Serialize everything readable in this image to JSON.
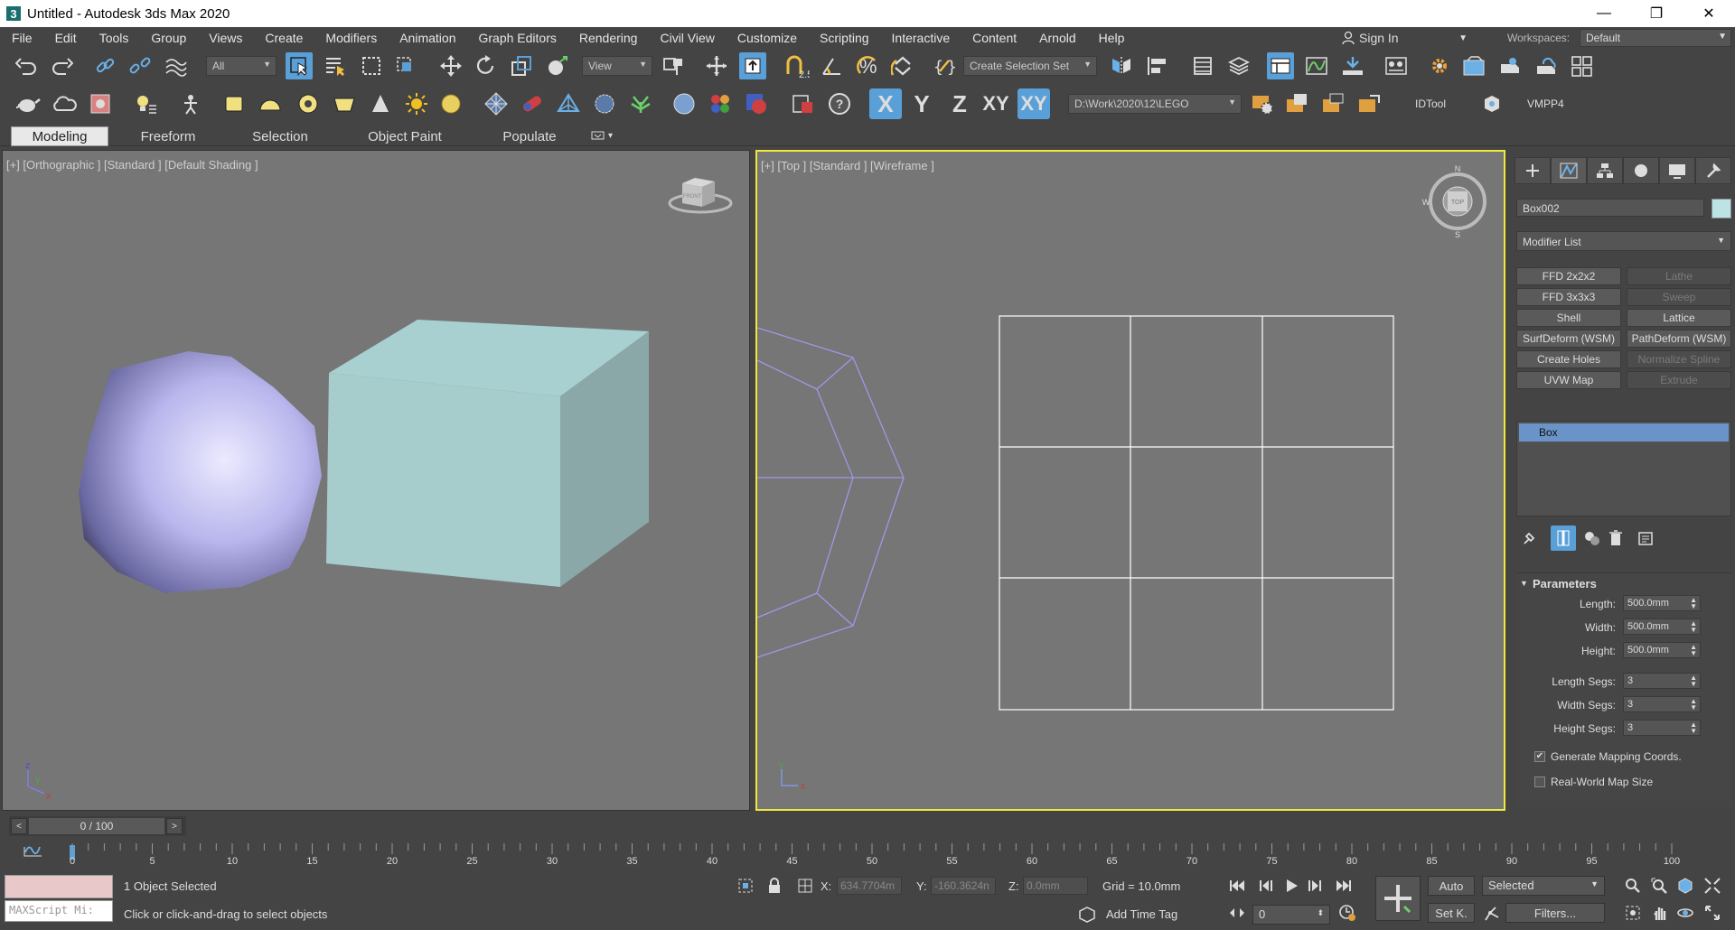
{
  "window": {
    "title": "Untitled - Autodesk 3ds Max 2020",
    "minimize": "—",
    "maximize": "❐",
    "close": "✕"
  },
  "menu": [
    "File",
    "Edit",
    "Tools",
    "Group",
    "Views",
    "Create",
    "Modifiers",
    "Animation",
    "Graph Editors",
    "Rendering",
    "Civil View",
    "Customize",
    "Scripting",
    "Interactive",
    "Content",
    "Arnold",
    "Help"
  ],
  "sign_in": "Sign In",
  "workspaces": {
    "label": "Workspaces:",
    "value": "Default"
  },
  "toolbar1": {
    "filter_value": "All",
    "ref_coord_value": "View",
    "selection_set_value": "Create Selection Set",
    "snap_label": "2.5"
  },
  "toolbar2": {
    "axis_x": "X",
    "axis_y": "Y",
    "axis_z": "Z",
    "axis_xy": "XY",
    "axis_xyz": "XY",
    "project_path": "D:\\Work\\2020\\12\\LEGO",
    "idtool": "IDTool",
    "vmpp4": "VMPP4"
  },
  "ribbon_tabs": [
    "Modeling",
    "Freeform",
    "Selection",
    "Object Paint",
    "Populate"
  ],
  "viewports": {
    "left_label": "[+] [Orthographic ] [Standard ] [Default Shading ]",
    "right_label": "[+] [Top ] [Standard ] [Wireframe ]",
    "viewcube_left": "FRONT",
    "viewcube_right": "TOP",
    "compass_n": "N",
    "compass_s": "S",
    "compass_w": "W",
    "axis_x": "x",
    "axis_y": "y",
    "axis_z": "z"
  },
  "command_panel": {
    "object_name": "Box002",
    "object_color": "#bde4e4",
    "modifier_list": "Modifier List",
    "modifier_buttons": [
      {
        "label": "FFD 2x2x2",
        "enabled": true
      },
      {
        "label": "Lathe",
        "enabled": false
      },
      {
        "label": "FFD 3x3x3",
        "enabled": true
      },
      {
        "label": "Sweep",
        "enabled": false
      },
      {
        "label": "Shell",
        "enabled": true
      },
      {
        "label": "Lattice",
        "enabled": true
      },
      {
        "label": "SurfDeform (WSM)",
        "enabled": true
      },
      {
        "label": "PathDeform (WSM)",
        "enabled": true
      },
      {
        "label": "Create Holes",
        "enabled": true
      },
      {
        "label": "Normalize Spline",
        "enabled": false
      },
      {
        "label": "UVW Map",
        "enabled": true
      },
      {
        "label": "Extrude",
        "enabled": false
      }
    ],
    "stack_item": "Box",
    "parameters": {
      "header": "Parameters",
      "rows": [
        {
          "label": "Length:",
          "value": "500.0mm"
        },
        {
          "label": "Width:",
          "value": "500.0mm"
        },
        {
          "label": "Height:",
          "value": "500.0mm"
        },
        {
          "label": "Length Segs:",
          "value": "3"
        },
        {
          "label": "Width Segs:",
          "value": "3"
        },
        {
          "label": "Height Segs:",
          "value": "3"
        }
      ],
      "generate_mapping": {
        "label": "Generate Mapping Coords.",
        "checked": true
      },
      "real_world": {
        "label": "Real-World Map Size",
        "checked": false
      }
    }
  },
  "timeline": {
    "slider_text": "0 / 100",
    "ticks": [
      "0",
      "5",
      "10",
      "15",
      "20",
      "25",
      "30",
      "35",
      "40",
      "45",
      "50",
      "55",
      "60",
      "65",
      "70",
      "75",
      "80",
      "85",
      "90",
      "95",
      "100"
    ]
  },
  "status": {
    "maxscript": "MAXScript Mi:",
    "selection_text": "1 Object Selected",
    "prompt_text": "Click or click-and-drag to select objects",
    "x_label": "X:",
    "x_value": "634.7704m",
    "y_label": "Y:",
    "y_value": "-160.3624n",
    "z_label": "Z:",
    "z_value": "0.0mm",
    "grid": "Grid = 10.0mm",
    "add_time_tag": "Add Time Tag",
    "auto": "Auto",
    "set_key": "Set K.",
    "key_mode": "Selected",
    "filters": "Filters...",
    "frame_value": "0"
  },
  "colors": {
    "accent": "#5aa0d8",
    "active_viewport_border": "#f0e83a",
    "sphere": "#b8b6ec",
    "box": "#bde4e4",
    "wireframe_sphere": "#9d98e8"
  }
}
